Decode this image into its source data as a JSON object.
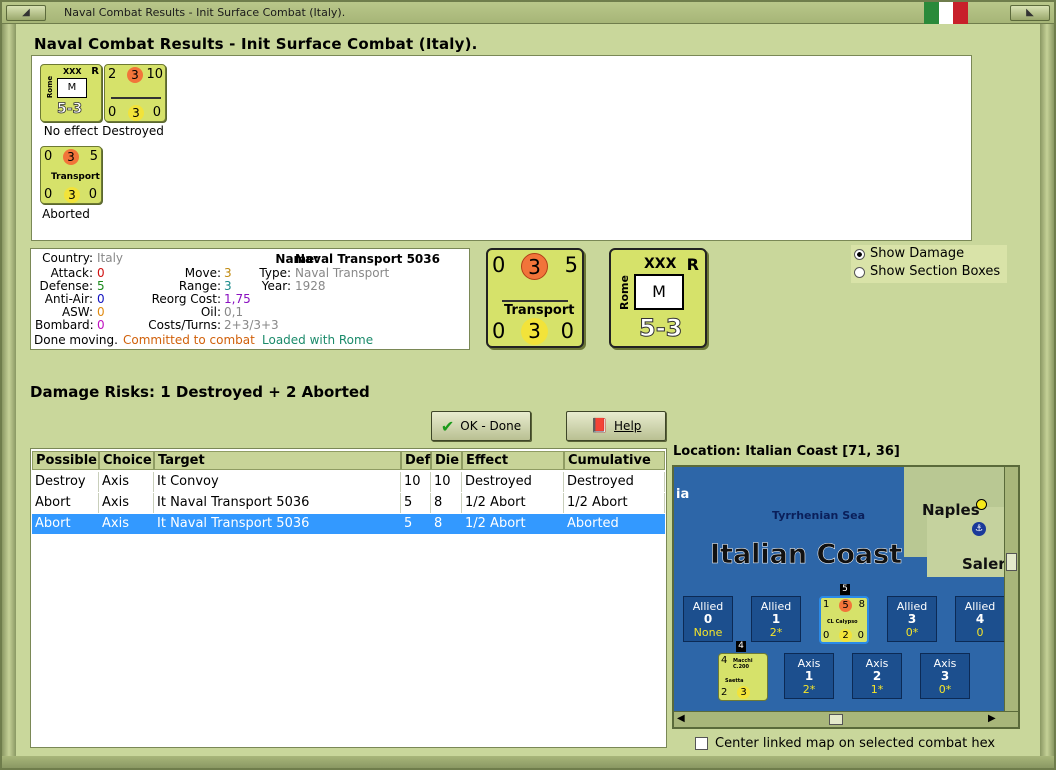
{
  "window": {
    "title": "Naval Combat Results - Init Surface Combat (Italy)."
  },
  "header": "Naval Combat Results - Init Surface Combat (Italy).",
  "units": [
    {
      "caption": "No effect",
      "top_label": "XXX",
      "corner": "R",
      "side": "Rome",
      "symbol": "M",
      "strength": "5-3"
    },
    {
      "caption": "Destroyed",
      "left": "2",
      "circle": "3",
      "right": "10",
      "bl": "0",
      "bc": "3",
      "br": "0"
    },
    {
      "caption": "Aborted",
      "left": "0",
      "circle": "3",
      "right": "5",
      "name": "Transport",
      "bl": "0",
      "bc": "3",
      "br": "0"
    }
  ],
  "info": {
    "country_label": "Country:",
    "country": "Italy",
    "attack_label": "Attack:",
    "attack": "0",
    "defense_label": "Defense:",
    "defense": "5",
    "antiair_label": "Anti-Air:",
    "antiair": "0",
    "asw_label": "ASW:",
    "asw": "0",
    "bombard_label": "Bombard:",
    "bombard": "0",
    "move_label": "Move:",
    "move": "3",
    "range_label": "Range:",
    "range": "3",
    "reorg_label": "Reorg Cost:",
    "reorg": "1,75",
    "oil_label": "Oil:",
    "oil": "0,1",
    "costs_label": "Costs/Turns:",
    "costs": "2+3/3+3",
    "name_label": "Name:",
    "name": "Naval Transport 5036",
    "type_label": "Type:",
    "type": "Naval Transport",
    "year_label": "Year:",
    "year": "1928",
    "status1": "Done moving.",
    "status2": "Committed to combat",
    "status3": "Loaded with Rome"
  },
  "big_transport": {
    "left": "0",
    "circle": "3",
    "right": "5",
    "name": "Transport",
    "bl": "0",
    "bc": "3",
    "br": "0"
  },
  "big_corps": {
    "top": "XXX",
    "corner": "R",
    "side": "Rome",
    "symbol": "M",
    "strength": "5-3"
  },
  "options": {
    "show_damage": "Show Damage",
    "show_sections": "Show Section Boxes"
  },
  "damage": "Damage Risks:  1 Destroyed + 2 Aborted",
  "buttons": {
    "ok": "OK - Done",
    "help": "Help"
  },
  "table": {
    "headers": [
      "Possible",
      "Choice",
      "Target",
      "Def",
      "Die",
      "Effect",
      "Cumulative"
    ],
    "rows": [
      [
        "Destroy",
        "Axis",
        "It Convoy",
        "10",
        "10",
        "Destroyed",
        "Destroyed"
      ],
      [
        "Abort",
        "Axis",
        "It Naval Transport 5036",
        "5",
        "8",
        "1/2 Abort",
        "1/2 Abort"
      ],
      [
        "Abort",
        "Axis",
        "It Naval Transport 5036",
        "5",
        "8",
        "1/2 Abort",
        "Aborted"
      ]
    ]
  },
  "location": "Location:  Italian Coast [71, 36]",
  "map": {
    "region": "Italian Coast",
    "sea": "Tyrrhenian Sea",
    "city": "Naples",
    "city2": "Saler",
    "edge": "ia",
    "allied": [
      {
        "label": "Allied",
        "num": "0",
        "sub": "None"
      },
      {
        "label": "Allied",
        "num": "1",
        "sub": "2*"
      },
      {
        "label": "Allied",
        "num": "3",
        "sub": "0*"
      },
      {
        "label": "Allied",
        "num": "4",
        "sub": "0"
      }
    ],
    "axis": [
      {
        "label": "Axis",
        "num": "1",
        "sub": "2*"
      },
      {
        "label": "Axis",
        "num": "2",
        "sub": "1*"
      },
      {
        "label": "Axis",
        "num": "3",
        "sub": "0*"
      }
    ],
    "ship": {
      "tl": "1",
      "circle": "5",
      "tr": "8",
      "name": "CL Calypso",
      "bl": "0",
      "bc": "2",
      "br": "0",
      "stack": "5"
    },
    "plane": {
      "tl": "4",
      "name": "Macchi C.200",
      "sub": "Saetta",
      "bl": "2",
      "bc": "3",
      "stack": "4"
    }
  },
  "center_check": "Center linked map on selected combat hex"
}
